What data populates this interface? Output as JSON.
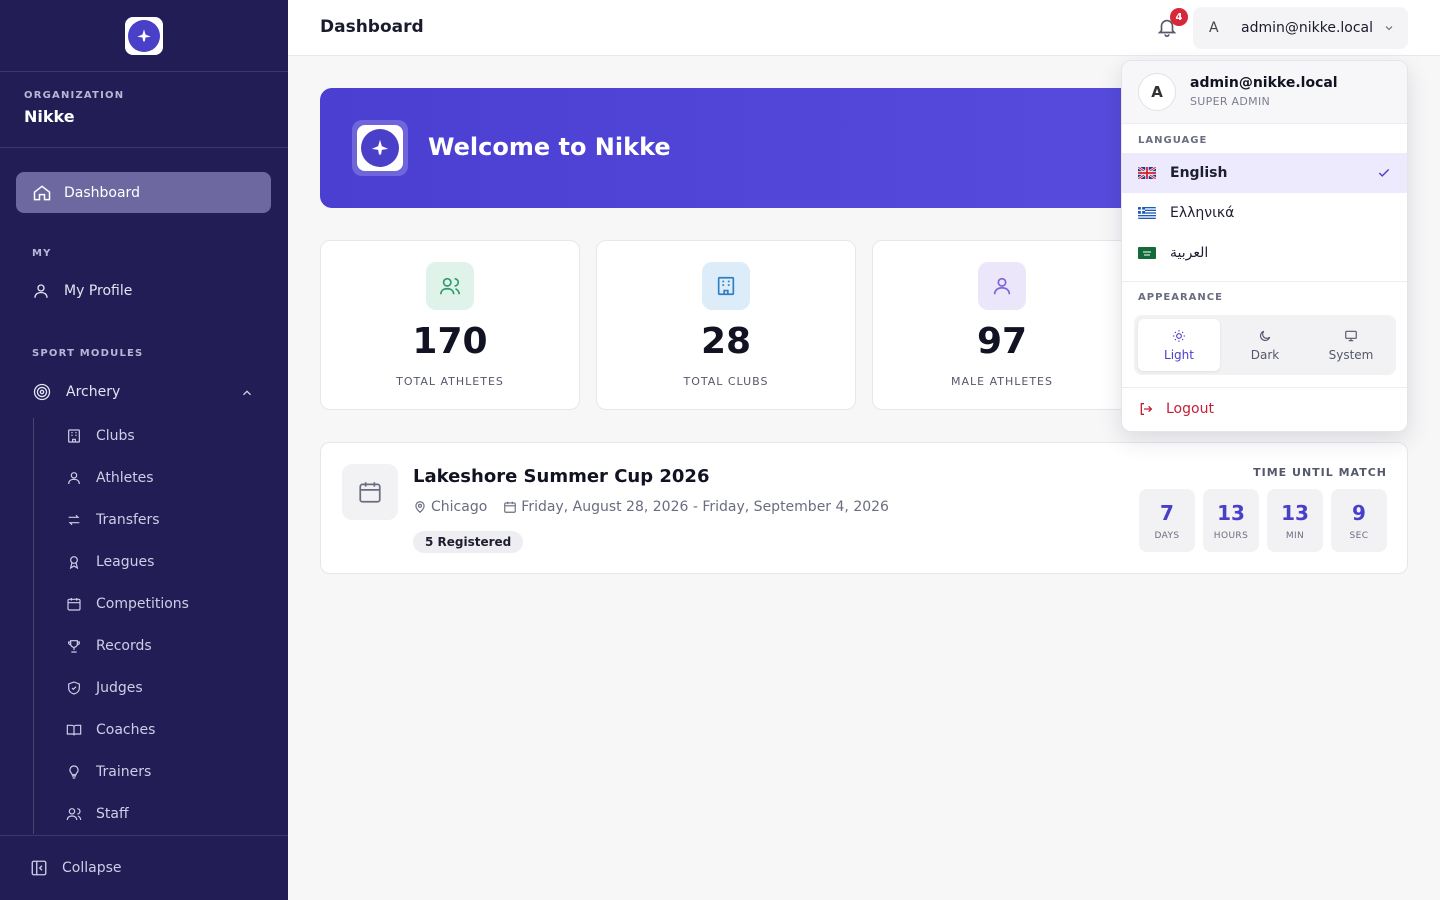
{
  "sidebar": {
    "org_label": "ORGANIZATION",
    "org_name": "Nikke",
    "dashboard_label": "Dashboard",
    "my_section": "MY",
    "my_profile": "My Profile",
    "sport_section": "SPORT MODULES",
    "archery": "Archery",
    "sub_items": [
      "Clubs",
      "Athletes",
      "Transfers",
      "Leagues",
      "Competitions",
      "Records",
      "Judges",
      "Coaches",
      "Trainers",
      "Staff"
    ],
    "collapse": "Collapse"
  },
  "header": {
    "title": "Dashboard",
    "notification_count": "4",
    "user_initial": "A",
    "user_email": "admin@nikke.local"
  },
  "banner": {
    "title": "Welcome to Nikke"
  },
  "stats": [
    {
      "value": "170",
      "label": "TOTAL ATHLETES"
    },
    {
      "value": "28",
      "label": "TOTAL CLUBS"
    },
    {
      "value": "97",
      "label": "MALE ATHLETES"
    }
  ],
  "event": {
    "title": "Lakeshore Summer Cup 2026",
    "location": "Chicago",
    "dates": "Friday, August 28, 2026 - Friday, September 4, 2026",
    "registered": "5 Registered",
    "until_label": "TIME UNTIL MATCH",
    "countdown": [
      {
        "value": "7",
        "unit": "DAYS"
      },
      {
        "value": "13",
        "unit": "HOURS"
      },
      {
        "value": "13",
        "unit": "MIN"
      },
      {
        "value": "9",
        "unit": "SEC"
      }
    ]
  },
  "dropdown": {
    "initial": "A",
    "email": "admin@nikke.local",
    "role": "SUPER ADMIN",
    "language_label": "LANGUAGE",
    "languages": [
      "English",
      "Ελληνικά",
      "العربية"
    ],
    "appearance_label": "APPEARANCE",
    "themes": [
      "Light",
      "Dark",
      "System"
    ],
    "logout": "Logout"
  },
  "colors": {
    "sidebar_bg": "#221d55",
    "accent": "#4a3fc8",
    "danger": "#c42035"
  }
}
